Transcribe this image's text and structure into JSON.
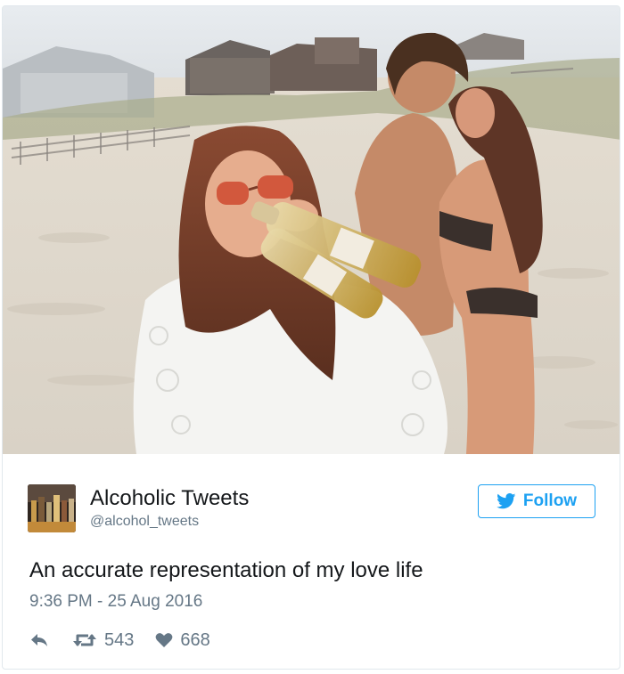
{
  "tweet": {
    "display_name": "Alcoholic Tweets",
    "handle": "@alcohol_tweets",
    "follow_label": "Follow",
    "text": "An accurate representation of my love life",
    "timestamp": "9:36 PM - 25 Aug 2016",
    "retweets": "543",
    "likes": "668"
  },
  "icons": {
    "follow": "twitter-bird-icon",
    "reply": "reply-icon",
    "retweet": "retweet-icon",
    "like": "heart-icon"
  },
  "colors": {
    "accent": "#1da1f2",
    "text": "#14171a",
    "muted": "#657786",
    "border": "#e1e8ed"
  }
}
